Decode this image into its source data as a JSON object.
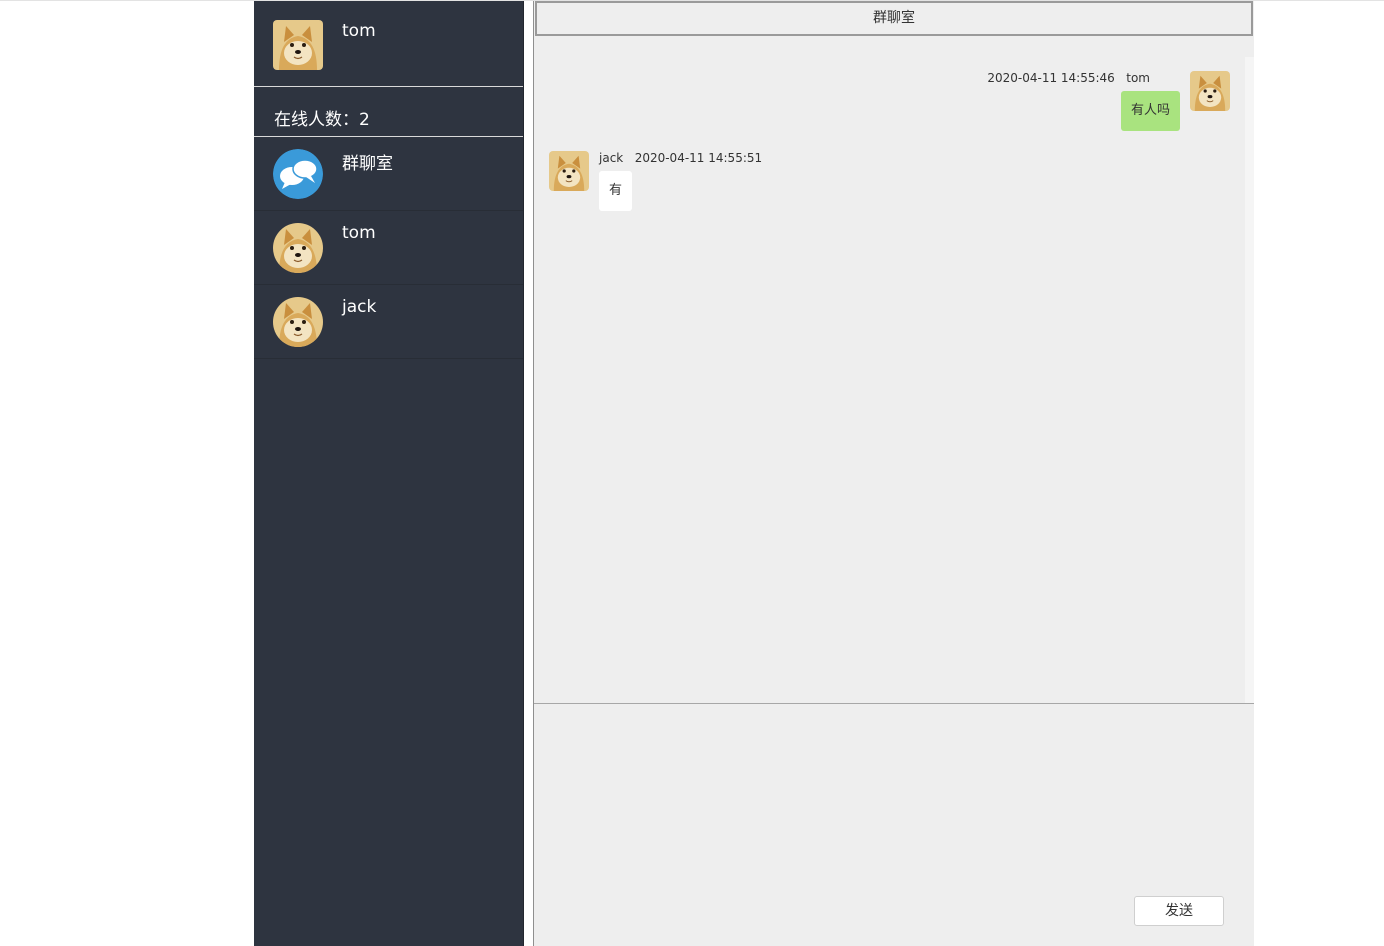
{
  "current_user": {
    "name": "tom",
    "avatar_icon": "shiba-dog-avatar"
  },
  "online": {
    "text": "在线人数：2"
  },
  "contacts": [
    {
      "name": "群聊室",
      "avatar_icon": "group-chat-icon"
    },
    {
      "name": "tom",
      "avatar_icon": "shiba-dog-avatar"
    },
    {
      "name": "jack",
      "avatar_icon": "shiba-dog-avatar"
    }
  ],
  "chat": {
    "title": "群聊室",
    "messages": [
      {
        "sender": "tom",
        "time": "2020-04-11 14:55:46",
        "text": "有人吗",
        "mine": true
      },
      {
        "sender": "jack",
        "time": "2020-04-11 14:55:51",
        "text": "有",
        "mine": false
      }
    ]
  },
  "composer": {
    "send_label": "发送"
  },
  "colors": {
    "sidebar_bg": "#2e3440",
    "chat_bg": "#eeeeee",
    "my_bubble": "#a9e37f",
    "other_bubble": "#ffffff"
  }
}
